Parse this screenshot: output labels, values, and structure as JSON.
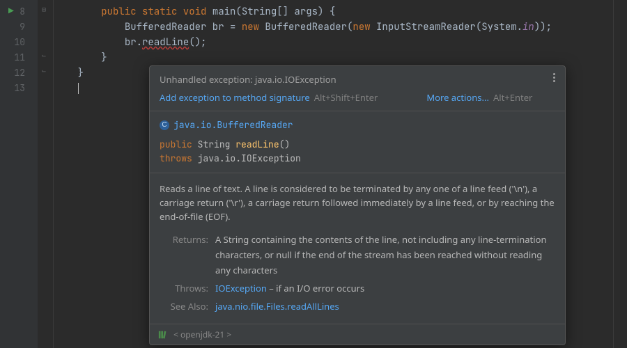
{
  "gutter": {
    "start": 8,
    "lines": [
      "8",
      "9",
      "10",
      "11",
      "12",
      "13"
    ]
  },
  "code": {
    "l8": {
      "indent": "        ",
      "kw1": "public static void ",
      "method": "main",
      "params": "(String[] args) {"
    },
    "l9": {
      "indent": "            ",
      "t1": "BufferedReader br = ",
      "kw": "new ",
      "t2": "BufferedReader(",
      "kw2": "new ",
      "t3": "InputStreamReader(System.",
      "field": "in",
      "t4": "));"
    },
    "l10": {
      "indent": "            ",
      "obj": "br.",
      "method": "readLine",
      "tail": "();"
    },
    "l11": {
      "indent": "        ",
      "brace": "}"
    },
    "l12": {
      "indent": "    ",
      "brace": "}"
    },
    "l13": {
      "indent": "    "
    }
  },
  "popup": {
    "title": "Unhandled exception: java.io.IOException",
    "action1": "Add exception to method signature",
    "sc1": "Alt+Shift+Enter",
    "action2": "More actions...",
    "sc2": "Alt+Enter",
    "class_icon": "C",
    "class": "java.io.BufferedReader",
    "sig_kw1": "public",
    "sig_ret": " String ",
    "sig_method": "readLine",
    "sig_paren": "()",
    "sig_kw2": "throws",
    "sig_ex": " java.io.IOException",
    "doc": "Reads a line of text. A line is considered to be terminated by any one of a line feed ('\\n'), a carriage return ('\\r'), a carriage return followed immediately by a line feed, or by reaching the end-of-file (EOF).",
    "returns_label": "Returns:",
    "returns": "A String containing the contents of the line, not including any line-termination characters, or null if the end of the stream has been reached without reading any characters",
    "throws_label": "Throws:",
    "throws_link": "IOException",
    "throws_text": " – if an I/O error occurs",
    "seealso_label": "See Also:",
    "seealso_link": "java.nio.file.Files.readAllLines",
    "footer": "< openjdk-21 >"
  }
}
